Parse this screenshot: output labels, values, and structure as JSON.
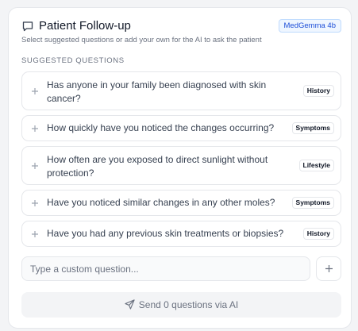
{
  "header": {
    "title": "Patient Follow-up",
    "model_badge": "MedGemma 4b",
    "subtitle": "Select suggested questions or add your own for the AI to ask the patient"
  },
  "section_label": "SUGGESTED QUESTIONS",
  "questions": [
    {
      "line1": "Has anyone in your family been diagnosed with skin",
      "line2": "cancer?",
      "tag": "History"
    },
    {
      "line1": "How quickly have you noticed the changes occurring?",
      "line2": "",
      "tag": "Symptoms"
    },
    {
      "line1": "How often are you exposed to direct sunlight without",
      "line2": "protection?",
      "tag": "Lifestyle"
    },
    {
      "line1": "Have you noticed similar changes in any other moles?",
      "line2": "",
      "tag": "Symptoms"
    },
    {
      "line1": "Have you had any previous skin treatments or biopsies?",
      "line2": "",
      "tag": "History"
    }
  ],
  "custom_question": {
    "placeholder": "Type a custom question...",
    "value": ""
  },
  "send_button": {
    "label": "Send 0 questions via AI"
  },
  "icons": {
    "header": "chat-icon",
    "question_add": "plus-icon",
    "custom_add": "plus-icon",
    "send": "send-icon"
  }
}
